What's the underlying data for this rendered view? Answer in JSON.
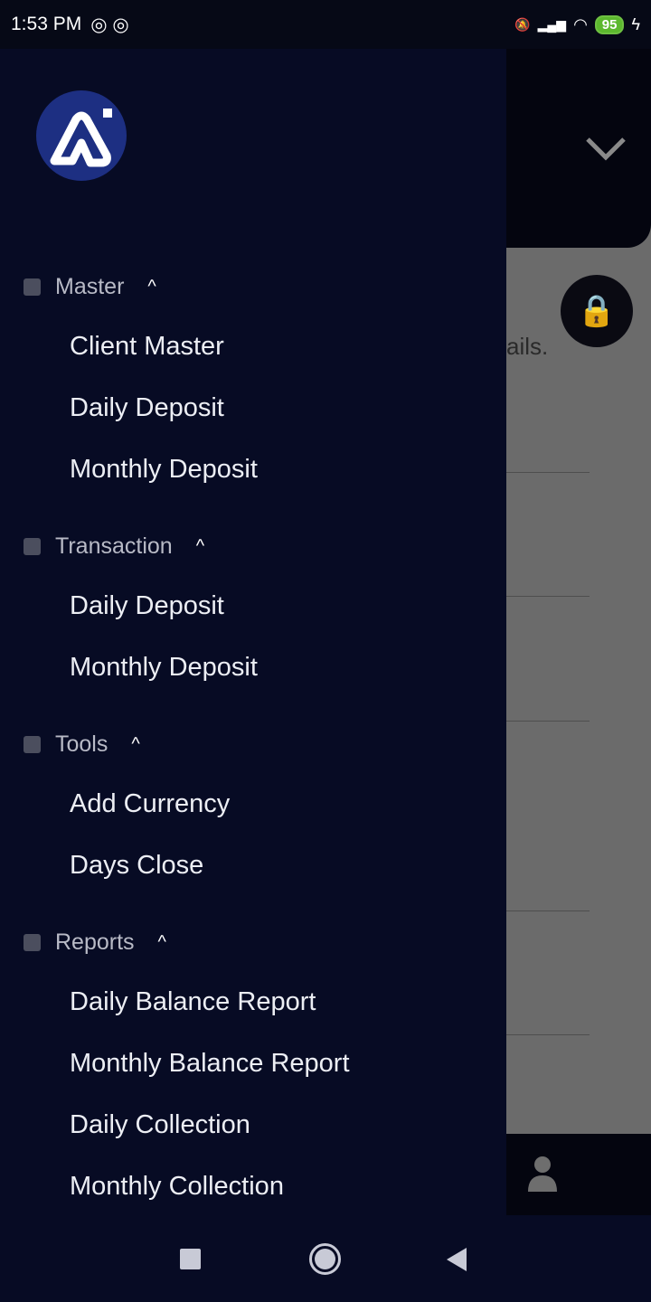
{
  "status_bar": {
    "time": "1:53 PM",
    "battery": "95"
  },
  "background": {
    "partial_text": "ails."
  },
  "drawer": {
    "sections": [
      {
        "title": "Master",
        "items": [
          "Client Master",
          "Daily Deposit",
          "Monthly Deposit"
        ]
      },
      {
        "title": "Transaction",
        "items": [
          "Daily Deposit",
          "Monthly Deposit"
        ]
      },
      {
        "title": "Tools",
        "items": [
          "Add Currency",
          "Days Close"
        ]
      },
      {
        "title": "Reports",
        "items": [
          "Daily Balance Report",
          "Monthly Balance Report",
          "Daily Collection",
          "Monthly Collection"
        ]
      }
    ]
  },
  "colors": {
    "drawer_bg": "#070b24",
    "logo_bg": "#1d2f82",
    "battery": "#5cb82e"
  }
}
